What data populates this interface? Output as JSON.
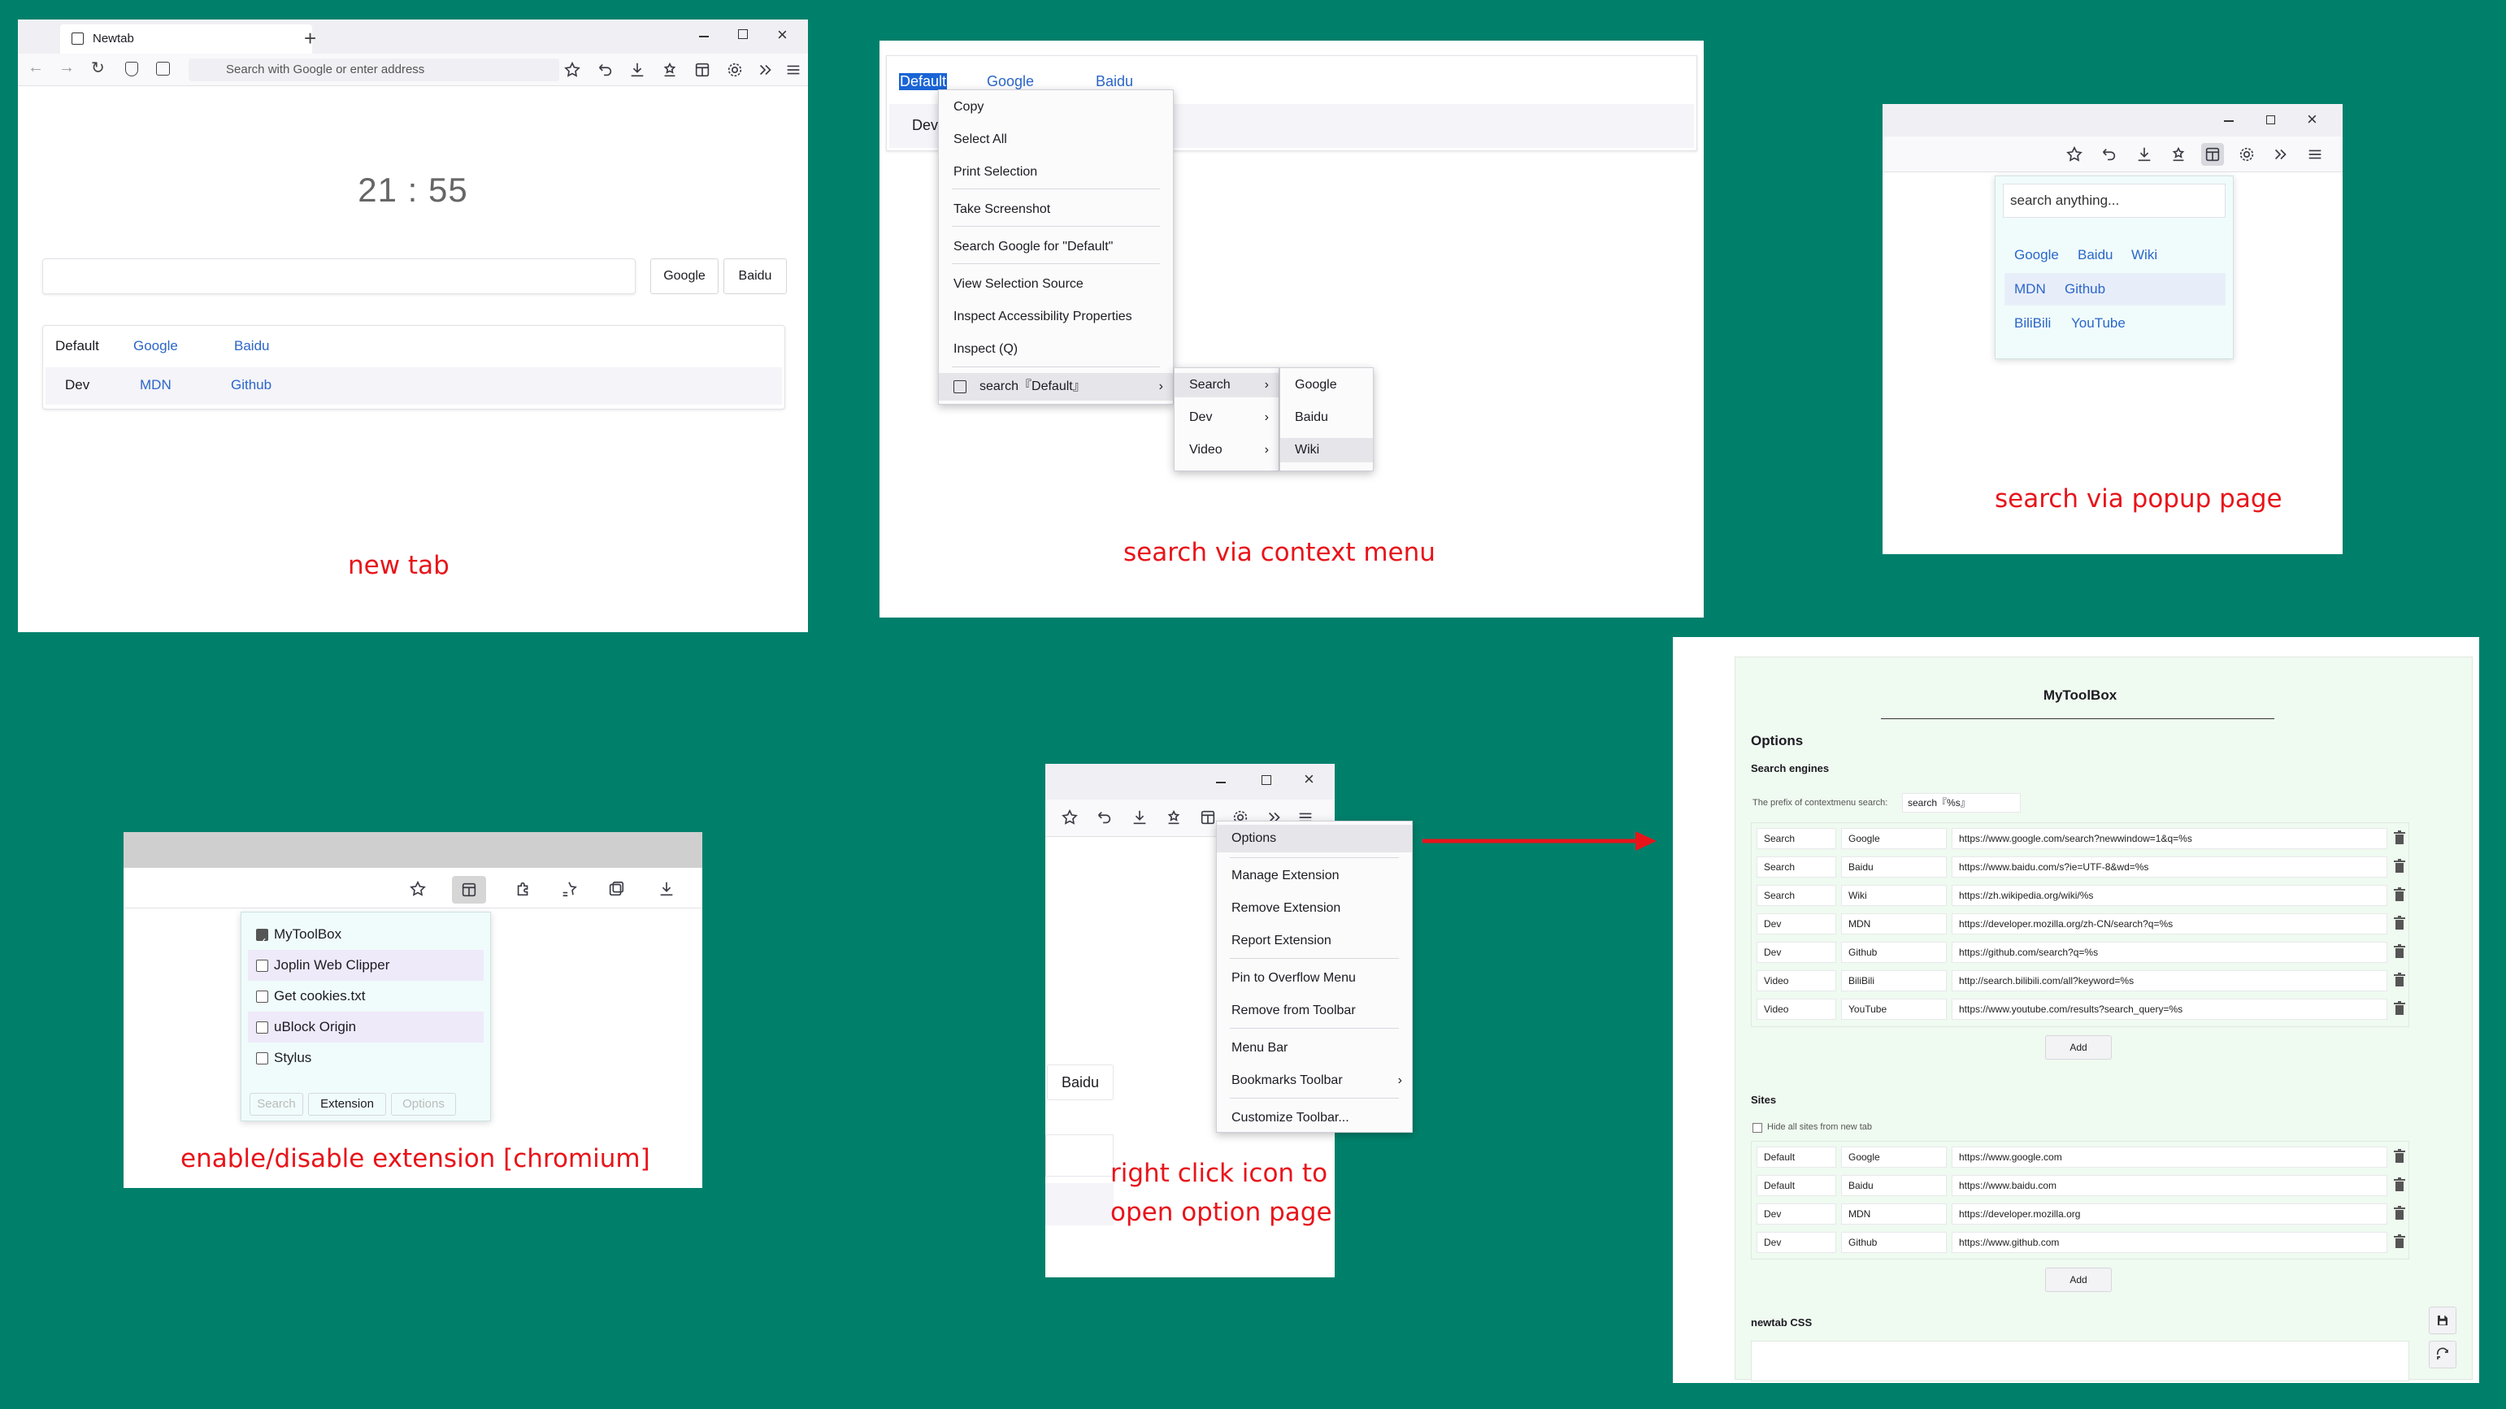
{
  "panel_newtab": {
    "tab_title": "Newtab",
    "address_placeholder": "Search with Google or enter address",
    "clock": "21 : 55",
    "buttons": [
      "Google",
      "Baidu"
    ],
    "sites": [
      {
        "group": "Default",
        "links": [
          "Google",
          "Baidu"
        ]
      },
      {
        "group": "Dev",
        "links": [
          "MDN",
          "Github"
        ]
      }
    ],
    "caption": "new tab"
  },
  "panel_context": {
    "row1": [
      "Default",
      "Google",
      "Baidu"
    ],
    "row2_label": "Dev",
    "menu_items": [
      "Copy",
      "Select All",
      "Print Selection",
      "Take Screenshot",
      "Search Google for \"Default\"",
      "View Selection Source",
      "Inspect Accessibility Properties",
      "Inspect (Q)",
      "search『Default』"
    ],
    "submenu": [
      "Search",
      "Dev",
      "Video"
    ],
    "subsubmenu": [
      "Google",
      "Baidu",
      "Wiki"
    ],
    "caption": "search via context menu"
  },
  "panel_popup": {
    "search_placeholder": "search anything...",
    "rows": [
      [
        "Google",
        "Baidu",
        "Wiki"
      ],
      [
        "MDN",
        "Github"
      ],
      [
        "BiliBili",
        "YouTube"
      ]
    ],
    "caption": "search via popup page"
  },
  "panel_extension": {
    "items": [
      {
        "label": "MyToolBox",
        "checked": true
      },
      {
        "label": "Joplin Web Clipper",
        "checked": false
      },
      {
        "label": "Get cookies.txt",
        "checked": false
      },
      {
        "label": "uBlock Origin",
        "checked": false
      },
      {
        "label": "Stylus",
        "checked": false
      }
    ],
    "tabs": [
      "Search",
      "Extension",
      "Options"
    ],
    "caption": "enable/disable extension [chromium]"
  },
  "panel_rightclick": {
    "menu_items": [
      "Options",
      "Manage Extension",
      "Remove Extension",
      "Report Extension",
      "Pin to Overflow Menu",
      "Remove from Toolbar",
      "Menu Bar",
      "Bookmarks Toolbar",
      "Customize Toolbar..."
    ],
    "side_label": "Baidu",
    "caption_line1": "right click icon to",
    "caption_line2": "open option page"
  },
  "panel_options": {
    "title": "MyToolBox",
    "heading": "Options",
    "search_engines_title": "Search engines",
    "prefix_label": "The prefix of contextmenu search:",
    "prefix_value": "search『%s』",
    "engines": [
      [
        "Search",
        "Google",
        "https://www.google.com/search?newwindow=1&q=%s"
      ],
      [
        "Search",
        "Baidu",
        "https://www.baidu.com/s?ie=UTF-8&wd=%s"
      ],
      [
        "Search",
        "Wiki",
        "https://zh.wikipedia.org/wiki/%s"
      ],
      [
        "Dev",
        "MDN",
        "https://developer.mozilla.org/zh-CN/search?q=%s"
      ],
      [
        "Dev",
        "Github",
        "https://github.com/search?q=%s"
      ],
      [
        "Video",
        "BiliBili",
        "http://search.bilibili.com/all?keyword=%s"
      ],
      [
        "Video",
        "YouTube",
        "https://www.youtube.com/results?search_query=%s"
      ]
    ],
    "add_label": "Add",
    "sites_title": "Sites",
    "hide_sites_label": "Hide all sites from new tab",
    "sites": [
      [
        "Default",
        "Google",
        "https://www.google.com"
      ],
      [
        "Default",
        "Baidu",
        "https://www.baidu.com"
      ],
      [
        "Dev",
        "MDN",
        "https://developer.mozilla.org"
      ],
      [
        "Dev",
        "Github",
        "https://www.github.com"
      ]
    ],
    "css_title": "newtab CSS"
  },
  "colors": {
    "background": "#00806b",
    "caption": "#e8141a",
    "link": "#2b66c9",
    "arrow": "#e8141a"
  }
}
